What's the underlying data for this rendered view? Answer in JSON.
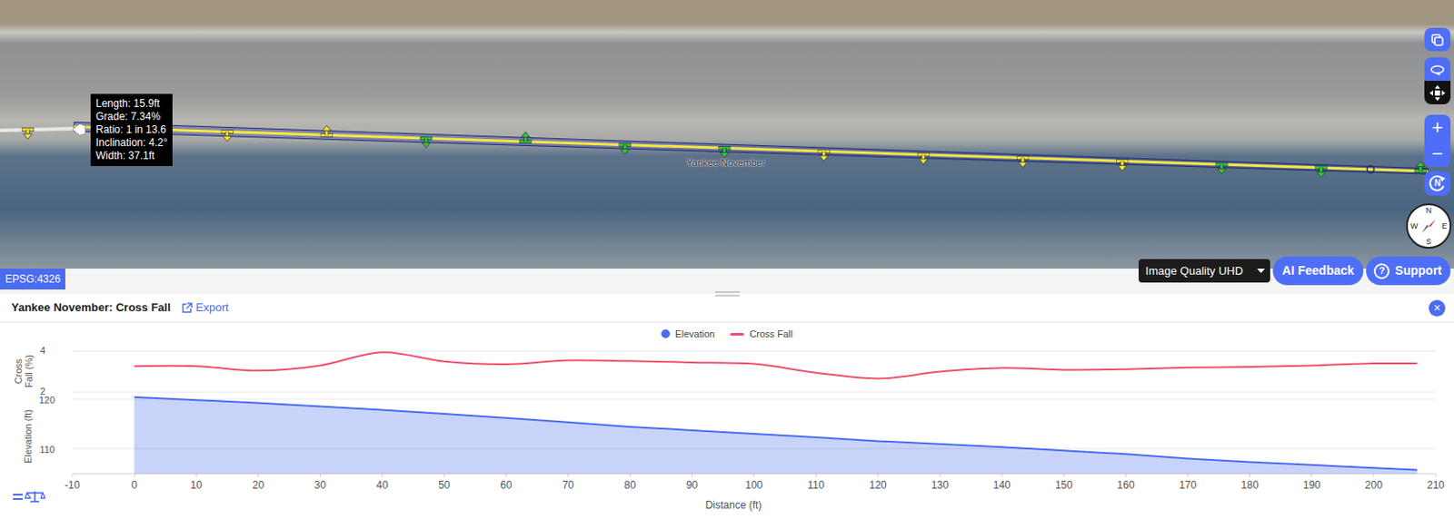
{
  "map": {
    "crs": "EPSG:4326",
    "measurement": [
      "Length: 15.9ft",
      "Grade: 7.34%",
      "Ratio: 1 in 13.6",
      "Inclination: 4.2°",
      "Width: 37.1ft"
    ],
    "route": {
      "label": "Yankee November",
      "arrows": [
        {
          "direction": "down",
          "color": "#f4e43a"
        },
        {
          "direction": "down",
          "color": "#f4e43a"
        },
        {
          "direction": "up",
          "color": "#f4e43a"
        },
        {
          "direction": "down",
          "color": "#2fc43f"
        },
        {
          "direction": "up",
          "color": "#2fc43f"
        },
        {
          "direction": "down",
          "color": "#2fc43f"
        },
        {
          "direction": "down",
          "color": "#2fc43f"
        },
        {
          "direction": "down",
          "color": "#f4e43a"
        },
        {
          "direction": "down",
          "color": "#f4e43a"
        },
        {
          "direction": "down",
          "color": "#f4e43a"
        },
        {
          "direction": "down",
          "color": "#f4e43a"
        },
        {
          "direction": "down",
          "color": "#2fc43f"
        },
        {
          "direction": "down",
          "color": "#2fc43f"
        },
        {
          "direction": "up",
          "color": "#2fc43f"
        }
      ]
    },
    "controls": {
      "zoom_in": "+",
      "zoom_out": "−",
      "north_reset": "N",
      "compass": [
        "N",
        "E",
        "S",
        "W"
      ]
    },
    "image_quality": "Image Quality UHD",
    "ai_feedback": "AI Feedback",
    "support": {
      "icon": "?",
      "label": "Support"
    }
  },
  "panel": {
    "title": "Yankee November: Cross Fall",
    "export": "Export",
    "close": "×",
    "chart": {
      "x_axis": {
        "label": "Distance (ft)",
        "ticks": [
          "-10",
          "0",
          "10",
          "20",
          "30",
          "40",
          "50",
          "60",
          "70",
          "80",
          "90",
          "100",
          "110",
          "120",
          "130",
          "140",
          "150",
          "160",
          "170",
          "180",
          "190",
          "200",
          "210"
        ]
      },
      "cross_fall_axis": {
        "label": "Cross Fall (%)",
        "ticks": [
          "4",
          "2"
        ]
      },
      "elevation_axis": {
        "label": "Elevation (ft)",
        "ticks": [
          "120",
          "110"
        ]
      },
      "distance": [
        0,
        10,
        20,
        30,
        40,
        50,
        60,
        70,
        80,
        90,
        100,
        110,
        120,
        130,
        140,
        150,
        160,
        170,
        180,
        190,
        200,
        207
      ],
      "series": [
        {
          "name": "Elevation",
          "color": "#4a6cf0",
          "values": [
            120.4,
            119.8,
            119.2,
            118.5,
            117.8,
            117.0,
            116.2,
            115.3,
            114.4,
            113.7,
            113.0,
            112.3,
            111.5,
            110.9,
            110.3,
            109.6,
            108.9,
            108.0,
            107.3,
            106.7,
            106.1,
            105.7
          ]
        },
        {
          "name": "Cross Fall",
          "color": "#f0506e",
          "values": [
            3.27,
            3.27,
            3.05,
            3.3,
            3.95,
            3.5,
            3.36,
            3.55,
            3.52,
            3.45,
            3.38,
            2.95,
            2.66,
            3.0,
            3.18,
            3.09,
            3.12,
            3.2,
            3.23,
            3.3,
            3.4,
            3.4
          ]
        }
      ]
    }
  }
}
